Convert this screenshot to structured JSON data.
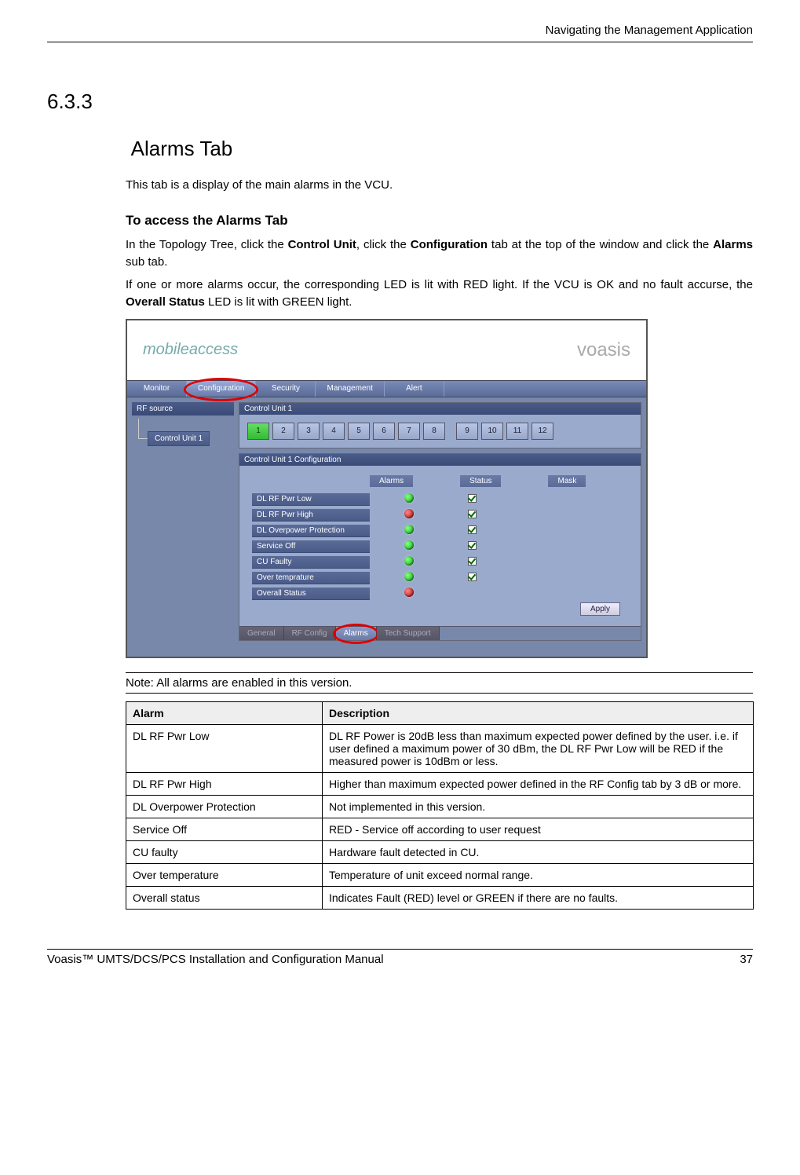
{
  "header": {
    "chapter": "Navigating the Management Application"
  },
  "section": {
    "number": "6.3.3",
    "title": "Alarms Tab"
  },
  "p1": "This tab is a display of the main alarms in the VCU.",
  "sub_heading": "To access the Alarms Tab",
  "p2_a": "In the Topology Tree, click the ",
  "p2_b": "Control Unit",
  "p2_c": ", click the ",
  "p2_d": "Configuration",
  "p2_e": " tab at the top of the window and click the ",
  "p2_f": "Alarms",
  "p2_g": " sub tab.",
  "p3_a": "If one or more alarms occur, the corresponding LED is lit with RED light. If the VCU is OK and no fault accurse, the ",
  "p3_b": "Overall Status",
  "p3_c": " LED is lit with GREEN light.",
  "app": {
    "logo_left": "mobileaccess",
    "logo_right": "voasis",
    "tabs": {
      "monitor": "Monitor",
      "configuration": "Configuration",
      "security": "Security",
      "management": "Management",
      "alert": "Alert"
    },
    "tree": {
      "root": "RF source",
      "item": "Control Unit 1"
    },
    "panel1": {
      "title": "Control Unit 1",
      "ports": [
        "1",
        "2",
        "3",
        "4",
        "5",
        "6",
        "7",
        "8",
        "9",
        "10",
        "11",
        "12"
      ],
      "active_port_index": 0
    },
    "panel2": {
      "title": "Control Unit 1 Configuration",
      "cols": {
        "alarms": "Alarms",
        "status": "Status",
        "mask": "Mask"
      },
      "rows": [
        {
          "label": "DL RF Pwr Low",
          "status": "green",
          "mask": true
        },
        {
          "label": "DL RF Pwr High",
          "status": "red",
          "mask": true
        },
        {
          "label": "DL Overpower Protection",
          "status": "green",
          "mask": true
        },
        {
          "label": "Service Off",
          "status": "green",
          "mask": true
        },
        {
          "label": "CU Faulty",
          "status": "green",
          "mask": true
        },
        {
          "label": "Over temprature",
          "status": "green",
          "mask": true
        },
        {
          "label": "Overall Status",
          "status": "red",
          "mask": false
        }
      ],
      "apply": "Apply",
      "subtabs": {
        "general": "General",
        "rfconfig": "RF Config",
        "alarms": "Alarms",
        "tech": "Tech Support"
      }
    }
  },
  "note": "Note: All alarms are enabled in this version.",
  "table": {
    "h1": "Alarm",
    "h2": "Description",
    "rows": [
      {
        "a": "DL RF Pwr Low",
        "d": "DL RF Power is 20dB less than maximum expected power defined by the user. i.e. if user defined a maximum power of 30 dBm, the DL RF Pwr Low will be RED if the measured power is 10dBm or less."
      },
      {
        "a": "DL RF Pwr High",
        "d": "Higher than maximum expected power defined in the RF Config tab by 3 dB or more."
      },
      {
        "a": "DL Overpower Protection",
        "d": "Not implemented in this version."
      },
      {
        "a": "Service Off",
        "d": "RED - Service off according to user request"
      },
      {
        "a": "CU faulty",
        "d": "Hardware fault detected in CU."
      },
      {
        "a": "Over temperature",
        "d": "Temperature of unit exceed normal range."
      },
      {
        "a": "Overall status",
        "d": "Indicates Fault (RED) level or GREEN if there are no faults."
      }
    ]
  },
  "footer": {
    "left": "Voasis™ UMTS/DCS/PCS Installation and Configuration Manual",
    "right": "37"
  }
}
